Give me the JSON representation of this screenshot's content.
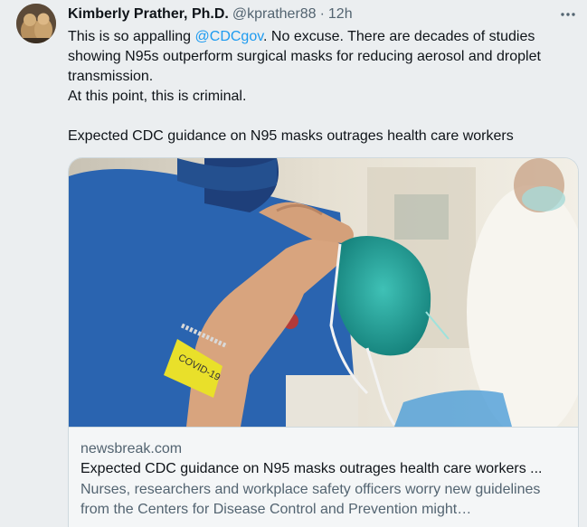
{
  "author": {
    "display_name": "Kimberly Prather, Ph.D.",
    "handle": "@kprather88",
    "separator": "·",
    "time": "12h"
  },
  "more_icon": "more-horizontal-icon",
  "tweet": {
    "line1_prefix": "This is so appalling ",
    "mention": "@CDCgov",
    "line1_suffix": ". No excuse. There are decades of studies showing N95s outperform surgical masks for reducing aerosol and droplet transmission.",
    "line2": "At this point, this is criminal.",
    "line3": "Expected CDC guidance on N95 masks outrages health care workers"
  },
  "card": {
    "domain": "newsbreak.com",
    "title": "Expected CDC guidance on N95 masks outrages health care workers ...",
    "description": "Nurses, researchers and workplace safety officers worry new guidelines from the Centers for Disease Control and Prevention might…",
    "wristband_text": "COVID-19"
  },
  "colors": {
    "link": "#1d9bf0",
    "secondary_text": "#536471",
    "primary_text": "#0f1419",
    "border": "#cfd9de",
    "background": "#ebeef0"
  }
}
